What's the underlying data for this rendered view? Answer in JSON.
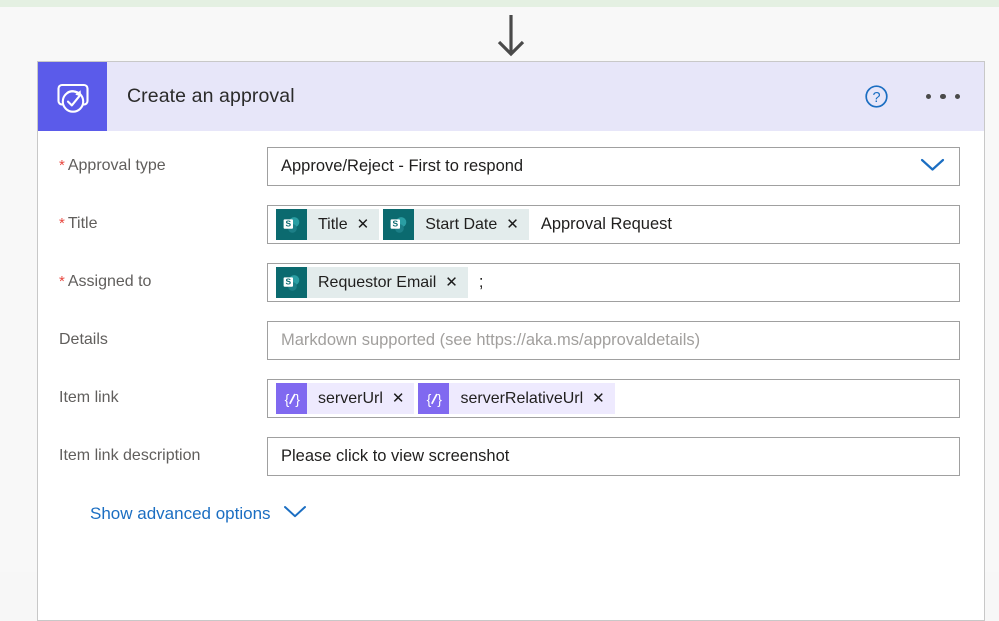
{
  "colors": {
    "accent_purple": "#5b5bea",
    "header_band": "#e7e6f9",
    "link_blue": "#1b6ec2",
    "required_red": "#e8473f",
    "sharepoint_teal": "#0b6a6f",
    "expression_purple": "#8069f0",
    "canvas": "#f8f8f8",
    "top_strip_green": "#e4f0e2"
  },
  "connector": {
    "icon": "arrow-down-icon"
  },
  "card": {
    "header": {
      "icon": "approval-icon",
      "title": "Create an approval",
      "help_icon": "help-circle-icon",
      "more_icon": "more-ellipsis-icon"
    },
    "rows": [
      {
        "label": "Approval type",
        "required": true,
        "type": "dropdown",
        "value": "Approve/Reject - First to respond",
        "chevron_icon": "chevron-down-icon"
      },
      {
        "label": "Title",
        "required": true,
        "type": "tokens",
        "tokens": [
          {
            "kind": "sharepoint",
            "icon": "sharepoint-icon",
            "label": "Title",
            "remove_icon": "close-icon"
          },
          {
            "kind": "sharepoint",
            "icon": "sharepoint-icon",
            "label": "Start Date",
            "remove_icon": "close-icon"
          }
        ],
        "trailing_text": "Approval Request"
      },
      {
        "label": "Assigned to",
        "required": true,
        "type": "tokens",
        "tokens": [
          {
            "kind": "sharepoint",
            "icon": "sharepoint-icon",
            "label": "Requestor Email",
            "remove_icon": "close-icon"
          }
        ],
        "trailing_text": ";"
      },
      {
        "label": "Details",
        "required": false,
        "type": "text",
        "value": "",
        "placeholder": "Markdown supported (see https://aka.ms/approvaldetails)"
      },
      {
        "label": "Item link",
        "required": false,
        "type": "tokens",
        "tokens": [
          {
            "kind": "expression",
            "icon": "expression-icon",
            "label": "serverUrl",
            "remove_icon": "close-icon"
          },
          {
            "kind": "expression",
            "icon": "expression-icon",
            "label": "serverRelativeUrl",
            "remove_icon": "close-icon"
          }
        ],
        "trailing_text": ""
      },
      {
        "label": "Item link description",
        "required": false,
        "type": "text",
        "value": "Please click to view screenshot",
        "placeholder": ""
      }
    ],
    "advanced": {
      "label": "Show advanced options",
      "chevron_icon": "chevron-down-icon"
    }
  }
}
